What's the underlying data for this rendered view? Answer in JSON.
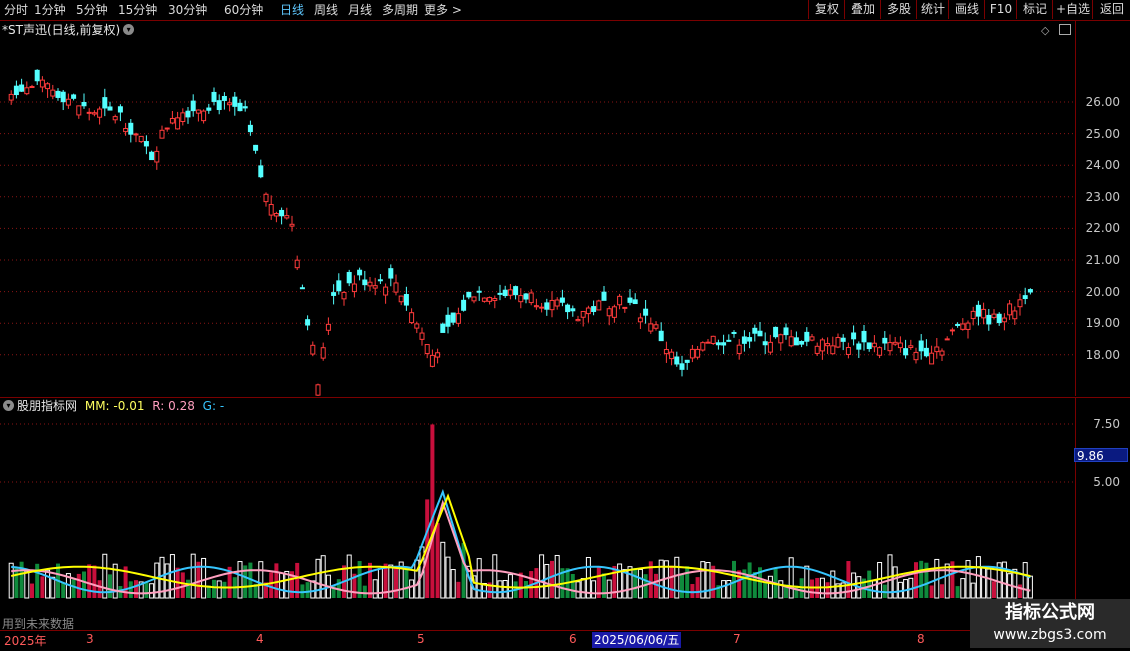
{
  "toolbar": {
    "periods": [
      "分时",
      "1分钟",
      "5分钟",
      "15分钟",
      "30分钟",
      "60分钟",
      "日线",
      "周线",
      "月线",
      "多周期",
      "更多 >"
    ],
    "selected": "日线",
    "right_buttons": [
      "复权",
      "叠加",
      "多股",
      "统计",
      "画线",
      "F10",
      "标记",
      "+自选",
      "返回"
    ]
  },
  "main": {
    "title": "*ST声迅(日线,前复权)",
    "price_labels": [
      "26.00",
      "25.00",
      "24.00",
      "23.00",
      "22.00",
      "21.00",
      "20.00",
      "19.00",
      "18.00"
    ],
    "price_levels": [
      26,
      25,
      24,
      23,
      22,
      21,
      20,
      19,
      18
    ]
  },
  "indicator": {
    "name": "股朋指标网",
    "mm": "MM: -0.01",
    "r": "R: 0.28",
    "g": "G: -",
    "axis_labels": [
      "7.50",
      "5.00"
    ],
    "axis_levels": [
      7.5,
      5.0
    ],
    "cursor_value": "9.86",
    "future_note": "用到未来数据"
  },
  "date_axis": {
    "labels": [
      "2025年",
      "3",
      "4",
      "5",
      "6",
      "7",
      "8"
    ],
    "highlight": "2025/06/06/五"
  },
  "watermark": {
    "line1": "指标公式网",
    "line2": "www.zbgs3.com"
  },
  "colors": {
    "up": "#ff3b3b",
    "down": "#54ffff",
    "yellow": "#ffff00",
    "pink": "#ff9fbf",
    "cyan": "#36c6ff",
    "grid": "#8a1515"
  }
}
